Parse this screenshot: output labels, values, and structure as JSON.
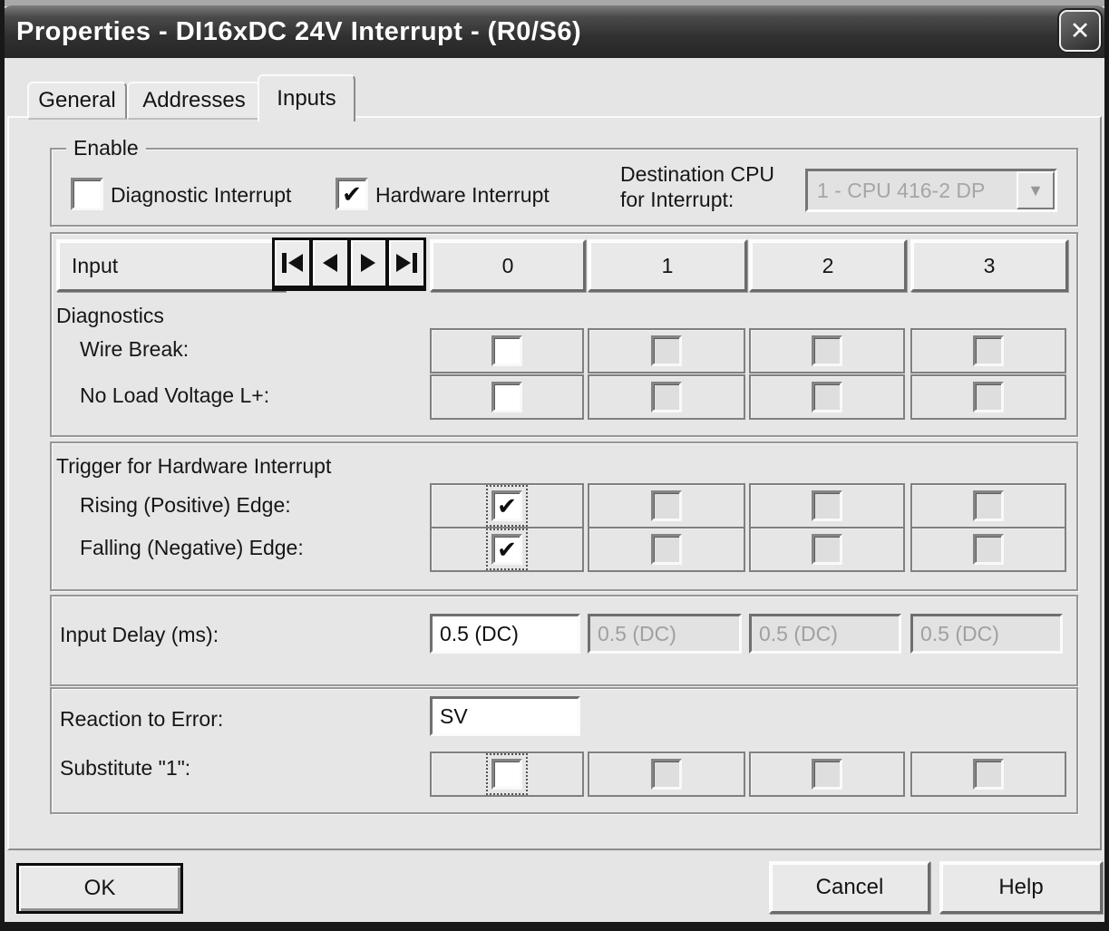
{
  "window": {
    "title": "Properties - DI16xDC 24V Interrupt - (R0/S6)"
  },
  "icons": {
    "close": "✕",
    "check": "✔",
    "dropdown_arrow": "▼"
  },
  "tabs": [
    {
      "label": "General",
      "active": false
    },
    {
      "label": "Addresses",
      "active": false
    },
    {
      "label": "Inputs",
      "active": true
    }
  ],
  "enable_group": {
    "legend": "Enable",
    "diagnostic_interrupt": {
      "label": "Diagnostic Interrupt",
      "checked": false
    },
    "hardware_interrupt": {
      "label": "Hardware Interrupt",
      "checked": true
    },
    "destination_cpu": {
      "label_line1": "Destination CPU",
      "label_line2": "for Interrupt:",
      "value": "1 - CPU 416-2 DP",
      "enabled": false
    }
  },
  "table": {
    "row_header_label": "Input",
    "nav_buttons": [
      "first",
      "previous",
      "next",
      "last"
    ],
    "columns": [
      "0",
      "1",
      "2",
      "3"
    ],
    "diagnostics": {
      "section_label": "Diagnostics",
      "wire_break": {
        "label": "Wire Break:",
        "checked": [
          false,
          false,
          false,
          false
        ],
        "enabled": [
          true,
          false,
          false,
          false
        ]
      },
      "no_load_voltage": {
        "label": "No Load Voltage L+:",
        "checked": [
          false,
          false,
          false,
          false
        ],
        "enabled": [
          true,
          false,
          false,
          false
        ]
      }
    },
    "trigger": {
      "section_label": "Trigger for Hardware Interrupt",
      "rising_edge": {
        "label": "Rising (Positive) Edge:",
        "checked": [
          true,
          false,
          false,
          false
        ],
        "enabled": [
          true,
          false,
          false,
          false
        ]
      },
      "falling_edge": {
        "label": "Falling (Negative) Edge:",
        "checked": [
          true,
          false,
          false,
          false
        ],
        "enabled": [
          true,
          false,
          false,
          false
        ]
      }
    },
    "input_delay": {
      "label": "Input Delay (ms):",
      "values": [
        "0.5 (DC)",
        "0.5 (DC)",
        "0.5 (DC)",
        "0.5 (DC)"
      ],
      "enabled": [
        true,
        false,
        false,
        false
      ]
    },
    "reaction": {
      "label": "Reaction to Error:",
      "value": "SV"
    },
    "substitute": {
      "label": "Substitute \"1\":",
      "checked": [
        false,
        false,
        false,
        false
      ],
      "enabled": [
        true,
        false,
        false,
        false
      ]
    }
  },
  "buttons": {
    "ok": "OK",
    "cancel": "Cancel",
    "help": "Help"
  },
  "colors": {
    "titlebar": "#3a3a3a",
    "dialog_bg": "#e5e5e5",
    "text": "#141414",
    "disabled_text": "#a0a0a0",
    "border_dark": "#808080"
  }
}
